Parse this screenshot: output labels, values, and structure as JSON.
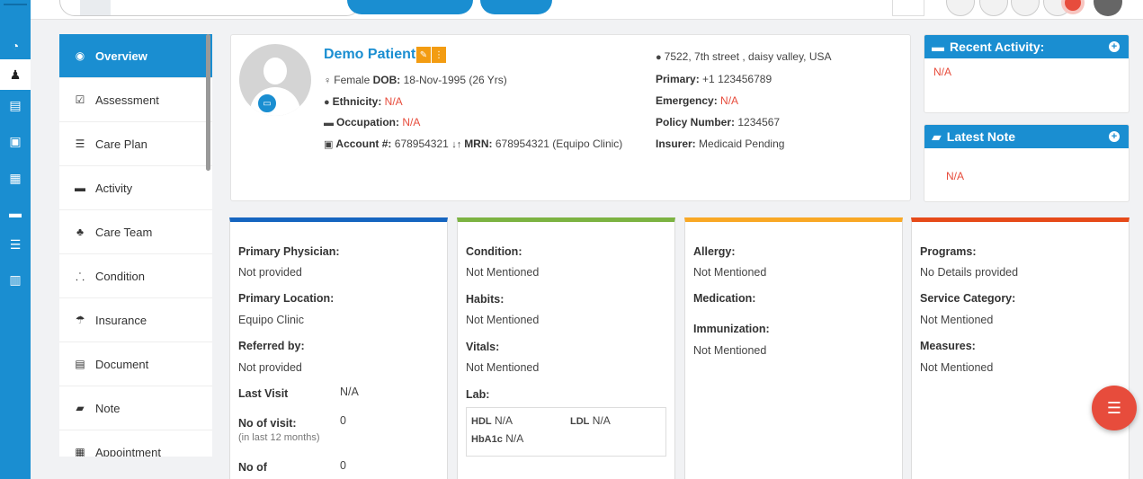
{
  "rail": {
    "icons": [
      "dashboard-icon",
      "user-icon",
      "file-icon",
      "medkit-icon",
      "id-card-icon",
      "briefcase-icon",
      "list-icon",
      "contact-book-icon"
    ]
  },
  "menu": {
    "items": [
      {
        "label": "Overview",
        "icon": "eye-icon",
        "glyph": "◉"
      },
      {
        "label": "Assessment",
        "icon": "checkbox-icon",
        "glyph": "☑"
      },
      {
        "label": "Care Plan",
        "icon": "list-icon",
        "glyph": "☰"
      },
      {
        "label": "Activity",
        "icon": "briefcase-icon",
        "glyph": "▬"
      },
      {
        "label": "Care Team",
        "icon": "users-icon",
        "glyph": "♣"
      },
      {
        "label": "Condition",
        "icon": "sitemap-icon",
        "glyph": "⸫"
      },
      {
        "label": "Insurance",
        "icon": "umbrella-icon",
        "glyph": "☂"
      },
      {
        "label": "Document",
        "icon": "document-icon",
        "glyph": "▤"
      },
      {
        "label": "Note",
        "icon": "note-icon",
        "glyph": "▰"
      },
      {
        "label": "Appointment",
        "icon": "calendar-icon",
        "glyph": "▦"
      }
    ]
  },
  "patient": {
    "name": "Demo Patient",
    "gender": "Female",
    "dob_label": "DOB:",
    "dob": "18-Nov-1995 (26 Yrs)",
    "ethnicity_label": "Ethnicity:",
    "ethnicity": "N/A",
    "occupation_label": "Occupation:",
    "occupation": "N/A",
    "account_label": "Account #:",
    "account": "678954321",
    "mrn_label": "MRN:",
    "mrn": "678954321 (Equipo Clinic)",
    "address": "7522, 7th street , daisy valley, USA",
    "primary_label": "Primary:",
    "primary": "+1 123456789",
    "emergency_label": "Emergency:",
    "emergency": "N/A",
    "policy_label": "Policy Number:",
    "policy": "1234567",
    "insurer_label": "Insurer:",
    "insurer": "Medicaid Pending"
  },
  "recent_activity": {
    "title": "Recent Activity:",
    "value": "N/A"
  },
  "latest_note": {
    "title": "Latest Note",
    "value": "N/A"
  },
  "card1": {
    "physician_label": "Primary Physician:",
    "physician": "Not provided",
    "location_label": "Primary Location:",
    "location": "Equipo Clinic",
    "referred_label": "Referred by:",
    "referred": "Not provided",
    "last_visit_label": "Last Visit",
    "last_visit": "N/A",
    "visits_label": "No of visit:",
    "visits": "0",
    "visits_sub": "(in last 12 months)",
    "noof_label": "No of",
    "noof": "0"
  },
  "card2": {
    "condition_label": "Condition:",
    "condition": "Not Mentioned",
    "habits_label": "Habits:",
    "habits": "Not Mentioned",
    "vitals_label": "Vitals:",
    "vitals": "Not Mentioned",
    "lab_label": "Lab:",
    "hdl_label": "HDL",
    "hdl": "N/A",
    "ldl_label": "LDL",
    "ldl": "N/A",
    "hba1c_label": "HbA1c",
    "hba1c": "N/A"
  },
  "card3": {
    "allergy_label": "Allergy:",
    "allergy": "Not Mentioned",
    "medication_label": "Medication:",
    "immunization_label": "Immunization:",
    "immunization": "Not Mentioned"
  },
  "card4": {
    "programs_label": "Programs:",
    "programs": "No Details provided",
    "service_label": "Service Category:",
    "service": "Not Mentioned",
    "measures_label": "Measures:",
    "measures": "Not Mentioned"
  },
  "colors": {
    "primary": "#1a8ed1",
    "danger": "#e74c3c",
    "warning": "#f39c12"
  }
}
